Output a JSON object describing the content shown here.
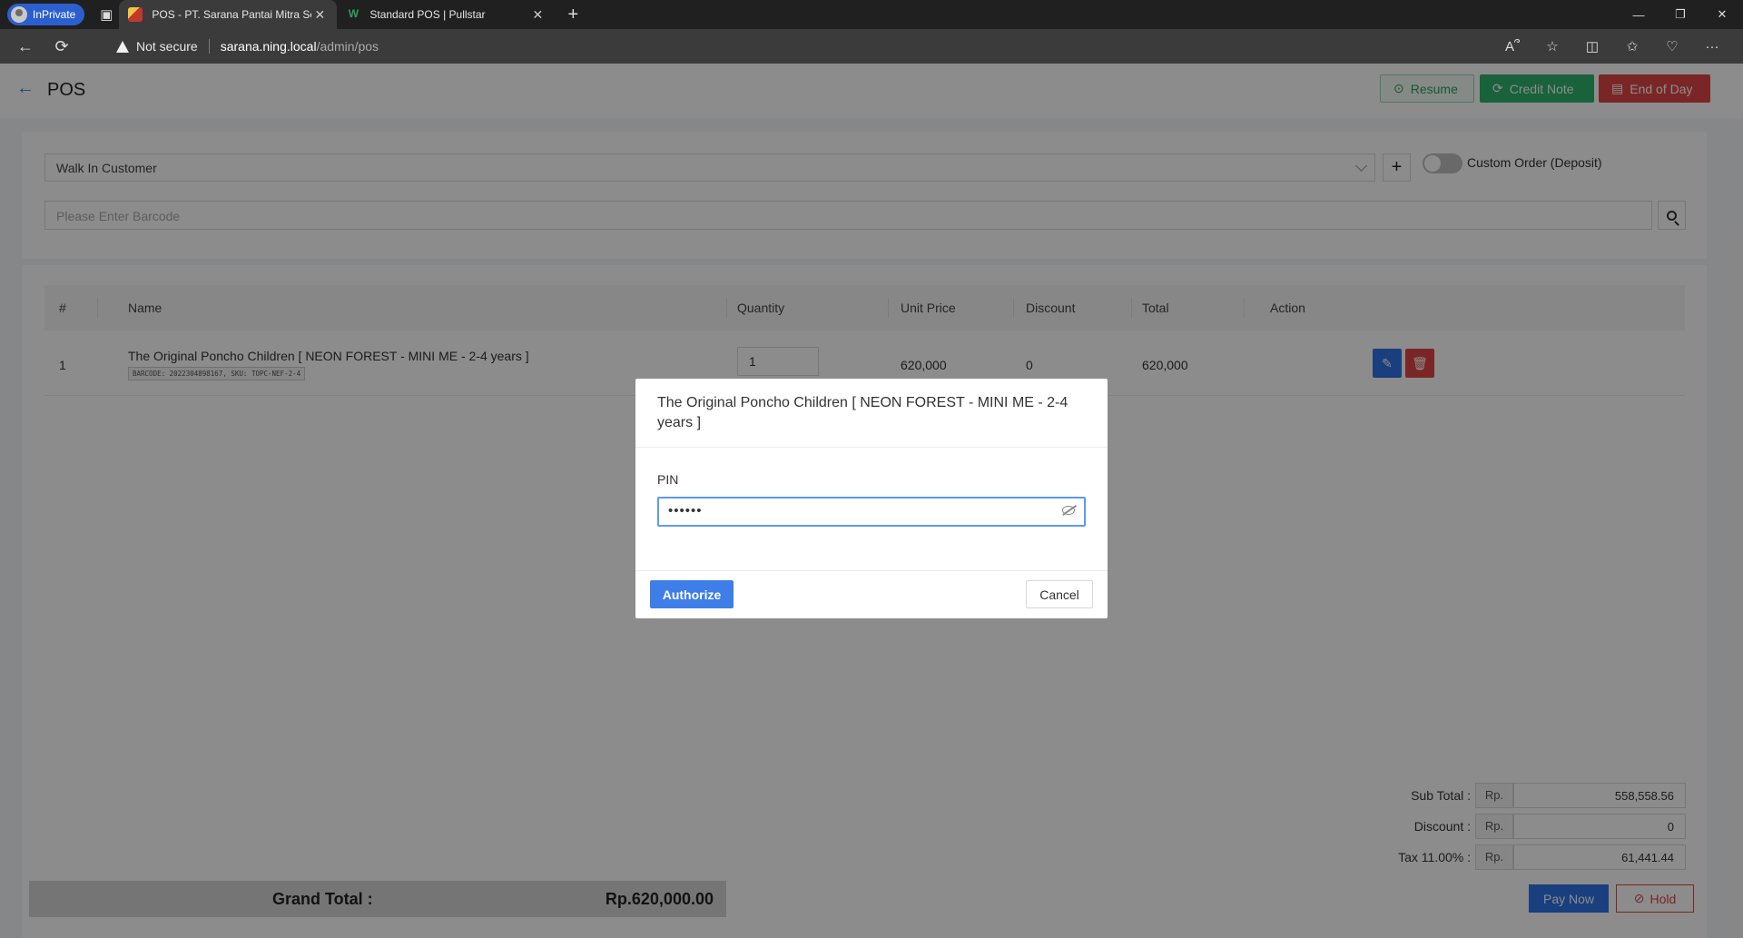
{
  "browser": {
    "inprivate_label": "InPrivate",
    "tabs": [
      {
        "title": "POS - PT. Sarana Pantai Mitra Se",
        "close": "✕"
      },
      {
        "title": "Standard POS | Pullstar",
        "close": "✕"
      }
    ],
    "new_tab": "+",
    "security_label": "Not secure",
    "url_host": "sarana.ning.local",
    "url_path": "/admin/pos"
  },
  "header": {
    "title": "POS",
    "resume_label": "Resume",
    "credit_note_label": "Credit Note",
    "end_of_day_label": "End of Day"
  },
  "customer": {
    "selected": "Walk In Customer",
    "custom_order_label": "Custom Order (Deposit)",
    "custom_order_enabled": false
  },
  "barcode": {
    "placeholder": "Please Enter Barcode"
  },
  "table": {
    "columns": [
      "#",
      "Name",
      "Quantity",
      "Unit Price",
      "Discount",
      "Total",
      "Action"
    ],
    "rows": [
      {
        "no": "1",
        "name": "The Original Poncho Children [ NEON FOREST - MINI ME - 2-4 years ]",
        "meta": "BARCODE: 2022304898167, SKU: TOPC-NEF-2-4",
        "quantity": "1",
        "unit_price": "620,000",
        "discount": "0",
        "total": "620,000"
      }
    ]
  },
  "summary": {
    "subtotal_label": "Sub Total :",
    "discount_label": "Discount :",
    "tax_label": "Tax 11.00% :",
    "currency": "Rp.",
    "subtotal": "558,558.56",
    "discount": "0",
    "tax": "61,441.44",
    "grand_total_label": "Grand Total :",
    "grand_total": "Rp.620,000.00",
    "pay_label": "Pay Now",
    "hold_label": "Hold"
  },
  "modal": {
    "title": "The Original Poncho Children [ NEON FOREST - MINI ME - 2-4 years ]",
    "pin_label": "PIN",
    "pin_value": "••••••",
    "authorize_label": "Authorize",
    "cancel_label": "Cancel"
  },
  "colors": {
    "primary": "#3073e6",
    "success": "#2fb36c",
    "danger": "#e04646"
  }
}
